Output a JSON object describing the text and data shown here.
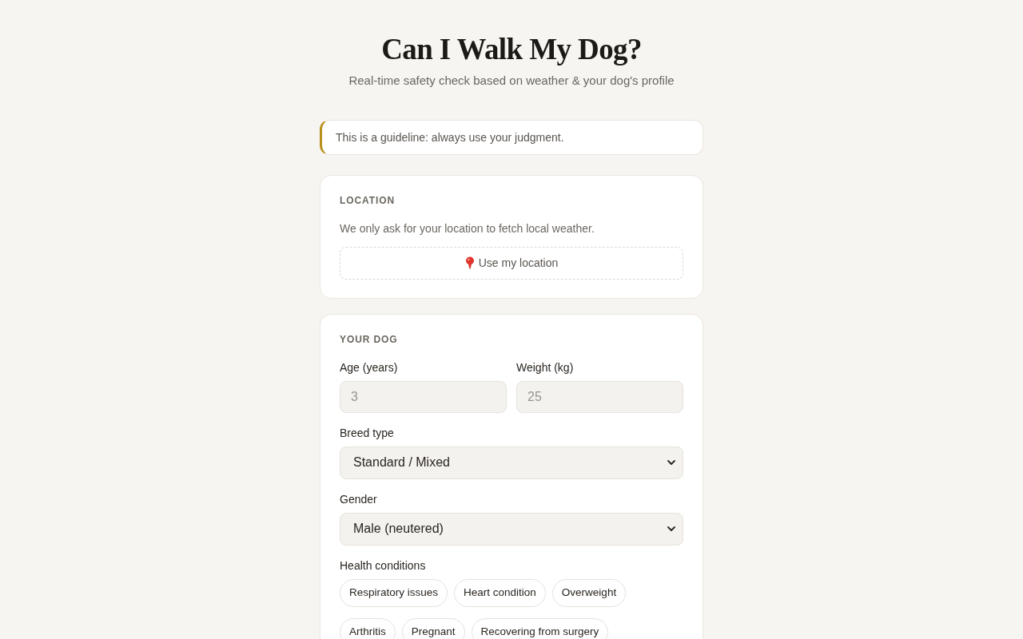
{
  "header": {
    "title": "Can I Walk My Dog?",
    "subtitle": "Real-time safety check based on weather & your dog's profile"
  },
  "notice": {
    "text": "This is a guideline: always use your judgment."
  },
  "location_section": {
    "heading": "LOCATION",
    "description": "We only ask for your location to fetch local weather.",
    "button": {
      "label": "Use my location"
    }
  },
  "dog_section": {
    "heading": "YOUR DOG",
    "field_rows": [
      {
        "fields": [
          {
            "kind": "input",
            "label": "Age (years)",
            "placeholder": "3"
          },
          {
            "kind": "input",
            "label": "Weight (kg)",
            "placeholder": "25"
          }
        ]
      },
      {
        "fields": [
          {
            "kind": "select",
            "label": "Breed type",
            "value": "Standard / Mixed"
          }
        ]
      },
      {
        "fields": [
          {
            "kind": "select",
            "label": "Gender",
            "value": "Male (neutered)"
          }
        ]
      }
    ],
    "health_conditions": {
      "label": "Health conditions",
      "options": [
        {
          "label": "Respiratory issues",
          "selected": false
        },
        {
          "label": "Heart condition",
          "selected": false
        },
        {
          "label": "Overweight",
          "selected": false
        },
        {
          "label": "Arthritis",
          "selected": false
        },
        {
          "label": "Pregnant",
          "selected": false
        },
        {
          "label": "Recovering from surgery",
          "selected": false
        }
      ]
    }
  }
}
